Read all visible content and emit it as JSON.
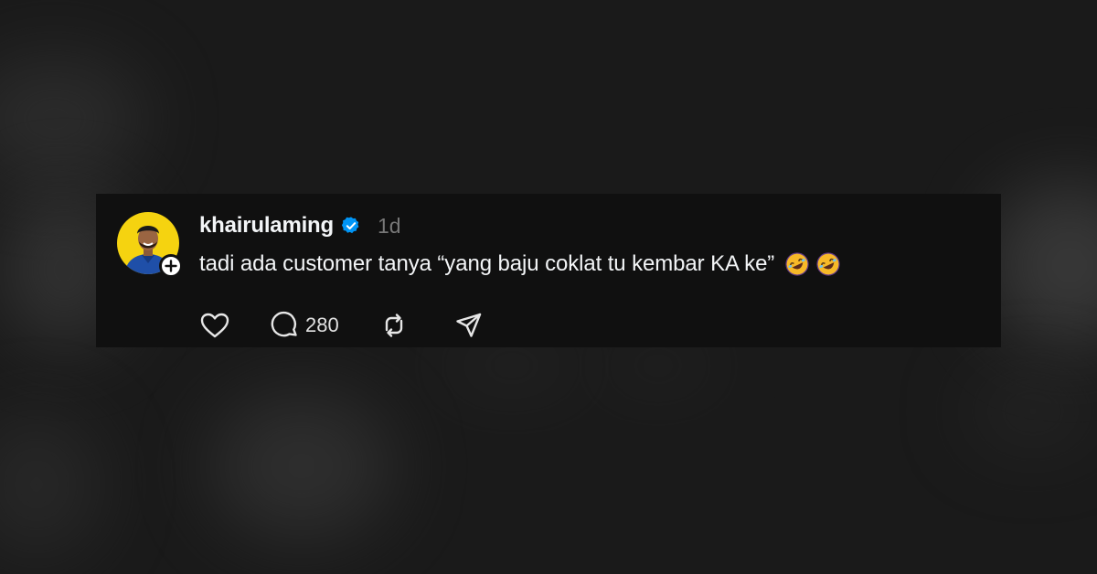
{
  "post": {
    "username": "khairulaming",
    "timestamp": "1d",
    "text": "tadi ada customer tanya “yang baju coklat tu kembar KA ke”",
    "emojis": [
      "rolling-on-floor-laughing-emoji",
      "rolling-on-floor-laughing-emoji"
    ],
    "verified": true,
    "avatar": {
      "background_color": "#f5d310",
      "icon": "profile-photo"
    },
    "follow_badge_icon": "plus-icon"
  },
  "actions": {
    "like_icon": "heart-icon",
    "reply_icon": "comment-bubble-icon",
    "reply_count": "280",
    "repost_icon": "repost-icon",
    "share_icon": "send-icon"
  },
  "colors": {
    "card_background": "#101010",
    "page_background": "#1a1a1a",
    "primary_text": "#f3f5f7",
    "secondary_text": "#777777",
    "verified_blue": "#0095f6"
  }
}
